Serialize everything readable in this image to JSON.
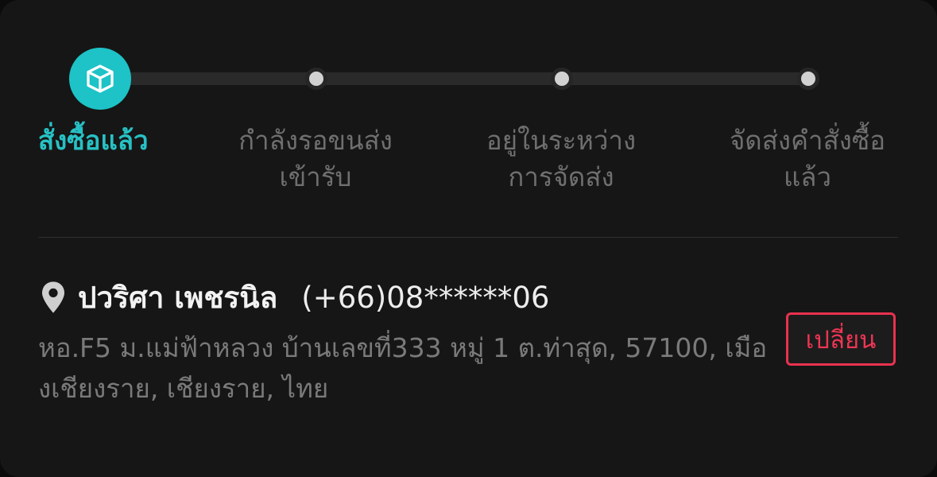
{
  "colors": {
    "accent": "#1dc3c6",
    "danger": "#e9324f",
    "background": "#161616",
    "muted_text": "#7a7a7a"
  },
  "progress": {
    "current_step": 1,
    "active_icon": "package-box-icon",
    "steps": [
      {
        "label": "สั่งซื้อแล้ว"
      },
      {
        "label": "กำลังรอขนส่ง\nเข้ารับ"
      },
      {
        "label": "อยู่ในระหว่าง\nการจัดส่ง"
      },
      {
        "label": "จัดส่งคำสั่งซื้อ\nแล้ว"
      }
    ]
  },
  "address": {
    "icon": "location-pin-icon",
    "name": "ปวริศา เพชรนิล",
    "phone": "(+66)08******06",
    "full_address": "หอ.F5 ม.แม่ฟ้าหลวง บ้านเลขที่333 หมู่ 1 ต.ท่าสุด, 57100, เมืองเชียงราย, เชียงราย, ไทย",
    "change_label": "เปลี่ยน"
  }
}
